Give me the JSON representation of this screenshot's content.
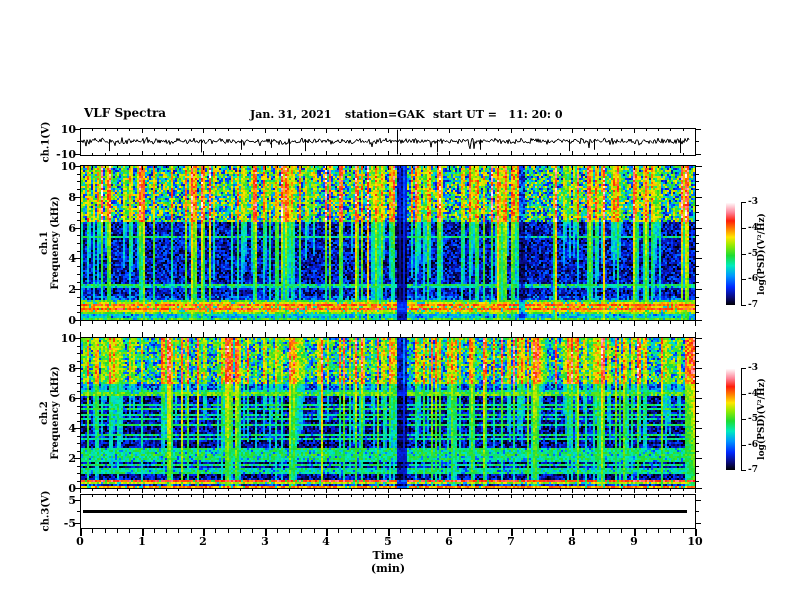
{
  "header": {
    "title": "VLF Spectra",
    "date": "Jan. 31, 2021",
    "station": "station=GAK",
    "start_ut": "start UT =   11: 20: 0"
  },
  "axes": {
    "x": {
      "label": "Time (min)",
      "tick_labels": [
        "0",
        "1",
        "2",
        "3",
        "4",
        "5",
        "6",
        "7",
        "8",
        "9",
        "10"
      ],
      "minors_per_interval": 4,
      "range_min": [
        0,
        10
      ]
    },
    "freq": {
      "tick_labels": [
        "0",
        "2",
        "4",
        "6",
        "8",
        "10"
      ],
      "unit": "kHz",
      "range_khz": [
        0,
        10
      ]
    },
    "ch1_wave": {
      "label": "ch.1(V)",
      "tick_labels": [
        "10",
        "-10"
      ],
      "range_v": [
        -10,
        10
      ]
    },
    "ch1_spec_label": {
      "line1": "ch.1",
      "line2": "Frequency (kHz)"
    },
    "ch2_spec_label": {
      "line1": "ch.2",
      "line2": "Frequency (kHz)"
    },
    "ch3_wave": {
      "label": "ch.3(V)",
      "tick_labels": [
        "5",
        "-5"
      ],
      "range_v": [
        -7,
        7
      ]
    }
  },
  "colorbar": {
    "label": "log(PSD)(V²/Hz)",
    "tick_labels": [
      "-3",
      "-4",
      "-5",
      "-6",
      "-7"
    ],
    "value_range": [
      -7,
      -3
    ]
  },
  "colormap_stops": [
    [
      0,
      0,
      0,
      10
    ],
    [
      0.07,
      10,
      10,
      120
    ],
    [
      0.17,
      0,
      40,
      255
    ],
    [
      0.28,
      0,
      150,
      255
    ],
    [
      0.38,
      0,
      235,
      190
    ],
    [
      0.48,
      30,
      220,
      50
    ],
    [
      0.58,
      150,
      235,
      0
    ],
    [
      0.66,
      255,
      230,
      0
    ],
    [
      0.74,
      255,
      130,
      0
    ],
    [
      0.82,
      255,
      30,
      10
    ],
    [
      0.9,
      255,
      130,
      150
    ],
    [
      1,
      255,
      255,
      255
    ]
  ],
  "chart_data": [
    {
      "type": "line",
      "name": "ch1_waveform",
      "ylabel": "ch.1(V)",
      "ylim": [
        -10,
        10
      ],
      "xlim": [
        0,
        10
      ],
      "xlabel": "Time (min)",
      "description": "noisy signal near 0 V with impulsive spikes",
      "baseline_v": 0.6,
      "noise_sigma_v": 1.1,
      "seed": 3,
      "spikes": [
        {
          "t": 0.45,
          "lo": -7,
          "hi": 2
        },
        {
          "t": 1.95,
          "lo": -8,
          "hi": 2
        },
        {
          "t": 2.6,
          "lo": -6,
          "hi": 2
        },
        {
          "t": 3.1,
          "lo": -4.5,
          "hi": 2
        },
        {
          "t": 3.38,
          "lo": -8.5,
          "hi": 2
        },
        {
          "t": 3.65,
          "lo": -7,
          "hi": 2
        },
        {
          "t": 5.15,
          "lo": -9.5,
          "hi": 9.5
        },
        {
          "t": 5.8,
          "lo": -8,
          "hi": 2
        },
        {
          "t": 6.5,
          "lo": -6,
          "hi": 2
        },
        {
          "t": 7.95,
          "lo": -7,
          "hi": 2
        },
        {
          "t": 8.35,
          "lo": -6,
          "hi": 2
        },
        {
          "t": 9.75,
          "lo": -8.5,
          "hi": 3
        }
      ]
    },
    {
      "type": "heatmap",
      "name": "ch1_spectrogram",
      "ylabel": "ch.1 Frequency (kHz)",
      "ylim_khz": [
        0,
        10
      ],
      "xlim_min": [
        0,
        10
      ],
      "zlabel": "log(PSD)(V²/Hz)",
      "zlim": [
        -7,
        -3
      ],
      "seed": 7,
      "regions": [
        {
          "f0": 6.3,
          "f1": 10.01,
          "base": 0.4,
          "noise": 0.3
        },
        {
          "f0": 1.55,
          "f1": 6.3,
          "base": 0.12,
          "noise": 0.13
        },
        {
          "f0": 0,
          "f1": 1.55,
          "base": 0.18,
          "noise": 0.16
        }
      ],
      "hlines": [
        {
          "f": 5.35,
          "hw": 0.08,
          "v": 0.42
        },
        {
          "f": 2.3,
          "hw": 0.07,
          "v": 0.45
        },
        {
          "f": 2.1,
          "hw": 0.07,
          "v": 0.38
        },
        {
          "f": 1.27,
          "hw": 0.07,
          "v": 0.5
        },
        {
          "f": 1.05,
          "hw": 0.1,
          "v": 0.64
        },
        {
          "f": 0.93,
          "hw": 0.07,
          "v": 0.78
        },
        {
          "f": 0.8,
          "hw": 0.07,
          "v": 0.68
        },
        {
          "f": 0.68,
          "hw": 0.07,
          "v": 0.8
        },
        {
          "f": 0.56,
          "hw": 0.07,
          "v": 0.66
        },
        {
          "f": 0.45,
          "hw": 0.07,
          "v": 0.55
        },
        {
          "f": 0.28,
          "hw": 0.12,
          "v": 0.32
        },
        {
          "f": 0.08,
          "hw": 0.07,
          "v": 0.5
        }
      ],
      "streaks": {
        "density": 0.5,
        "top_f": 6.3,
        "amp_min": 0.35,
        "amp_max": 1.0
      },
      "dark_columns": [
        {
          "t": 5.2,
          "w_min": 0.13,
          "k": 0.25
        },
        {
          "t": 7.15,
          "w_min": 0.07,
          "k": 0.5
        }
      ]
    },
    {
      "type": "heatmap",
      "name": "ch2_spectrogram",
      "ylabel": "ch.2 Frequency (kHz)",
      "ylim_khz": [
        0,
        10
      ],
      "xlim_min": [
        0,
        10
      ],
      "zlabel": "log(PSD)(V²/Hz)",
      "zlim": [
        -7,
        -3
      ],
      "seed": 13,
      "regions": [
        {
          "f0": 7.0,
          "f1": 10.01,
          "base": 0.38,
          "noise": 0.26
        },
        {
          "f0": 6.55,
          "f1": 7.0,
          "base": 0.2,
          "noise": 0.15
        },
        {
          "f0": 0.6,
          "f1": 6.55,
          "base": 0.09,
          "noise": 0.12
        },
        {
          "f0": 0,
          "f1": 0.6,
          "base": 0.15,
          "noise": 0.12
        }
      ],
      "hlines": [
        {
          "f": 6.25,
          "hw": 0.15,
          "v": 0.52
        },
        {
          "f": 6.5,
          "hw": 0.07,
          "v": 0.4
        },
        {
          "f": 5.55,
          "hw": 0.07,
          "v": 0.42
        },
        {
          "f": 5.25,
          "hw": 0.07,
          "v": 0.45
        },
        {
          "f": 4.9,
          "hw": 0.07,
          "v": 0.42
        },
        {
          "f": 4.55,
          "hw": 0.07,
          "v": 0.4
        },
        {
          "f": 4.2,
          "hw": 0.07,
          "v": 0.44
        },
        {
          "f": 3.55,
          "hw": 0.07,
          "v": 0.42
        },
        {
          "f": 3.25,
          "hw": 0.07,
          "v": 0.4
        },
        {
          "f": 2.65,
          "hw": 0.07,
          "v": 0.44
        },
        {
          "f": 2.4,
          "hw": 0.07,
          "v": 0.42
        },
        {
          "f": 2.2,
          "hw": 0.07,
          "v": 0.45
        },
        {
          "f": 2.0,
          "hw": 0.07,
          "v": 0.42
        },
        {
          "f": 1.8,
          "hw": 0.07,
          "v": 0.4
        },
        {
          "f": 1.55,
          "hw": 0.07,
          "v": 0.42
        },
        {
          "f": 1.2,
          "hw": 0.07,
          "v": 0.4
        },
        {
          "f": 0.95,
          "hw": 0.07,
          "v": 0.42
        },
        {
          "f": 0.45,
          "hw": 0.07,
          "v": 0.82
        },
        {
          "f": 0.33,
          "hw": 0.12,
          "v": 0.6
        },
        {
          "f": 0.12,
          "hw": 0.06,
          "v": 0.72
        }
      ],
      "streaks": {
        "density": 0.45,
        "top_f": 7.0,
        "amp_min": 0.3,
        "amp_max": 0.95
      },
      "dark_columns": [
        {
          "t": 5.2,
          "w_min": 0.13,
          "k": 0.3
        }
      ]
    },
    {
      "type": "line",
      "name": "ch3_waveform",
      "ylabel": "ch.3(V)",
      "ylim": [
        -7,
        7
      ],
      "xlim": [
        0,
        10
      ],
      "description": "constant flat signal at 0 V",
      "value_v": 0.0,
      "line_thickness_px": 3,
      "seed": 1
    }
  ]
}
